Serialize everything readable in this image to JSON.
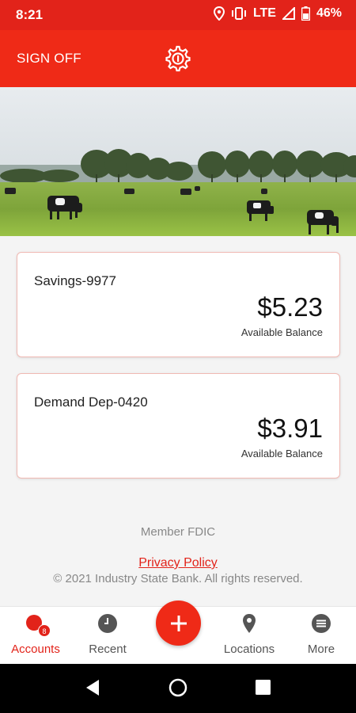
{
  "status_bar": {
    "time": "8:21",
    "network": "LTE",
    "battery": "46%",
    "icons": [
      "location-icon",
      "vibrate-icon",
      "signal-icon",
      "battery-icon"
    ]
  },
  "header": {
    "sign_off_label": "SIGN OFF",
    "settings_icon": "gear-icon"
  },
  "hero": {
    "image": "pasture-with-cows"
  },
  "accounts": [
    {
      "name": "Savings-9977",
      "balance": "$5.23",
      "caption": "Available Balance"
    },
    {
      "name": "Demand Dep-0420",
      "balance": "$3.91",
      "caption": "Available Balance"
    }
  ],
  "footer": {
    "member": "Member FDIC",
    "privacy": "Privacy Policy",
    "copyright": "© 2021 Industry State Bank. All rights reserved."
  },
  "bottom_nav": {
    "accounts": {
      "label": "Accounts",
      "badge": "8",
      "icon": "coins-icon"
    },
    "recent": {
      "label": "Recent",
      "icon": "clock-icon"
    },
    "add": {
      "icon": "plus-icon"
    },
    "locations": {
      "label": "Locations",
      "icon": "map-pin-icon"
    },
    "more": {
      "label": "More",
      "icon": "menu-icon"
    }
  },
  "colors": {
    "brand_red": "#ef2a17",
    "status_red": "#e2231a",
    "card_border": "#f0b9b3"
  }
}
